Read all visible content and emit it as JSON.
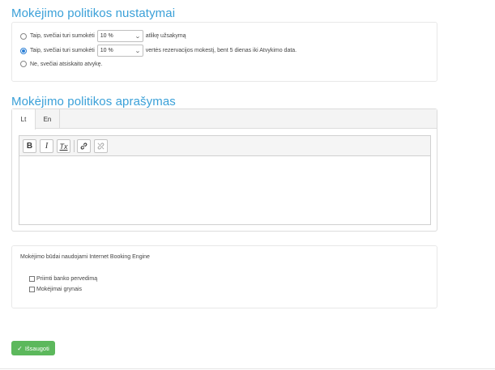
{
  "sections": {
    "policy_title": "Mokėjimo politikos nustatymai",
    "description_title": "Mokėjimo politikos aprašymas"
  },
  "policy": {
    "option1_prefix": "Taip, svečiai turi sumokėti",
    "option1_select": "10 %",
    "option1_suffix": "atlikę užsakymą",
    "option2_prefix": "Taip, svečiai turi sumokėti",
    "option2_select": "10 %",
    "option2_suffix": "vertės rezervacijos mokestį, bent 5 dienas iki Atvykimo data.",
    "option3_label": "Ne, svečiai atsiskaito atvykę.",
    "selected_option": 2
  },
  "description": {
    "tabs": [
      "Lt",
      "En"
    ],
    "active_tab": "Lt",
    "toolbar_icons": [
      "bold-icon",
      "italic-icon",
      "remove-format-icon",
      "link-icon",
      "unlink-icon"
    ],
    "bold_glyph": "B",
    "italic_glyph": "I",
    "clear_glyph": "Tx"
  },
  "engine": {
    "label": "Mokėjimo būdai naudojami Internet Booking Engine",
    "methods": [
      "Priimti banko pervedimą",
      "Mokėjimai grynais"
    ]
  },
  "actions": {
    "save_label": "Išsaugoti",
    "save_color": "#5cb85c"
  },
  "accent_color": "#3aa0d8"
}
